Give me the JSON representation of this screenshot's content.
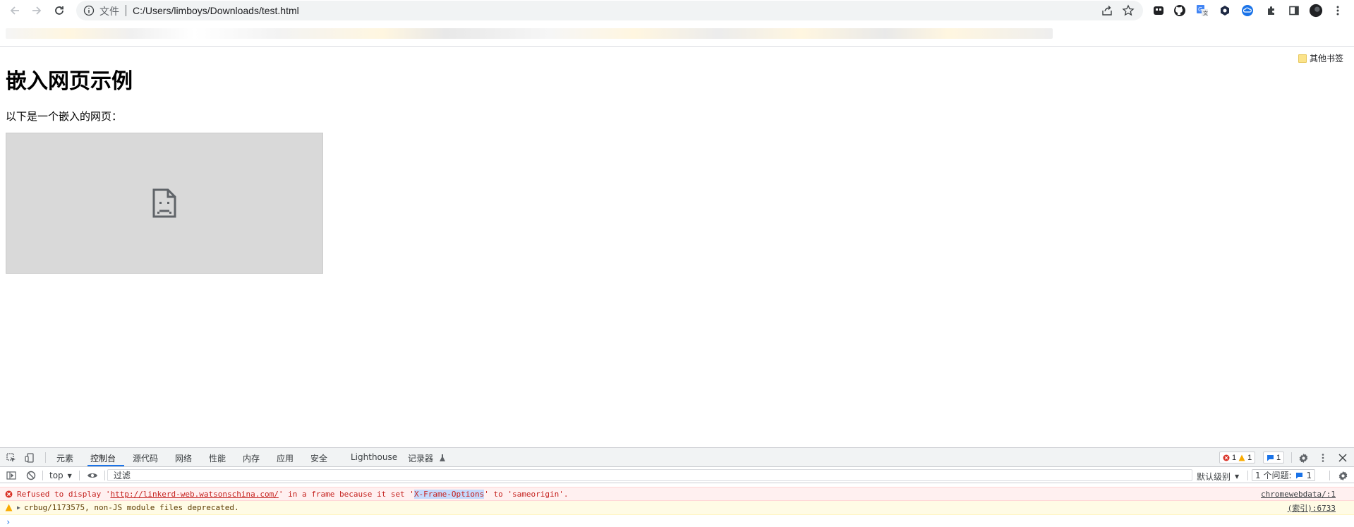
{
  "browser": {
    "omnibox": {
      "scheme_label": "文件",
      "url": "C:/Users/limboys/Downloads/test.html"
    },
    "bookmarks_other": "其他书签"
  },
  "page": {
    "heading": "嵌入网页示例",
    "intro": "以下是一个嵌入的网页："
  },
  "devtools": {
    "tabs": [
      "元素",
      "控制台",
      "源代码",
      "网络",
      "性能",
      "内存",
      "应用",
      "安全",
      "Lighthouse",
      "记录器"
    ],
    "badges": {
      "errors": "1",
      "warnings": "1",
      "messages": "1"
    },
    "context": "top",
    "filter_placeholder": "过滤",
    "level": "默认级别",
    "issues_label": "1 个问题:",
    "issues_count": "1",
    "console": [
      {
        "type": "error",
        "prefix": "Refused to display '",
        "link": "http://linkerd-web.watsonschina.com/",
        "mid": "' in a frame because it set '",
        "highlight": "X-Frame-Options",
        "suffix": "' to 'sameorigin'.",
        "source": "chromewebdata/:1"
      },
      {
        "type": "warning",
        "text": "crbug/1173575, non-JS module files deprecated.",
        "source": "(索引):6733"
      }
    ]
  },
  "colors": {
    "accent": "#1a73e8",
    "error": "#c5221f",
    "warning": "#f9ab00"
  }
}
